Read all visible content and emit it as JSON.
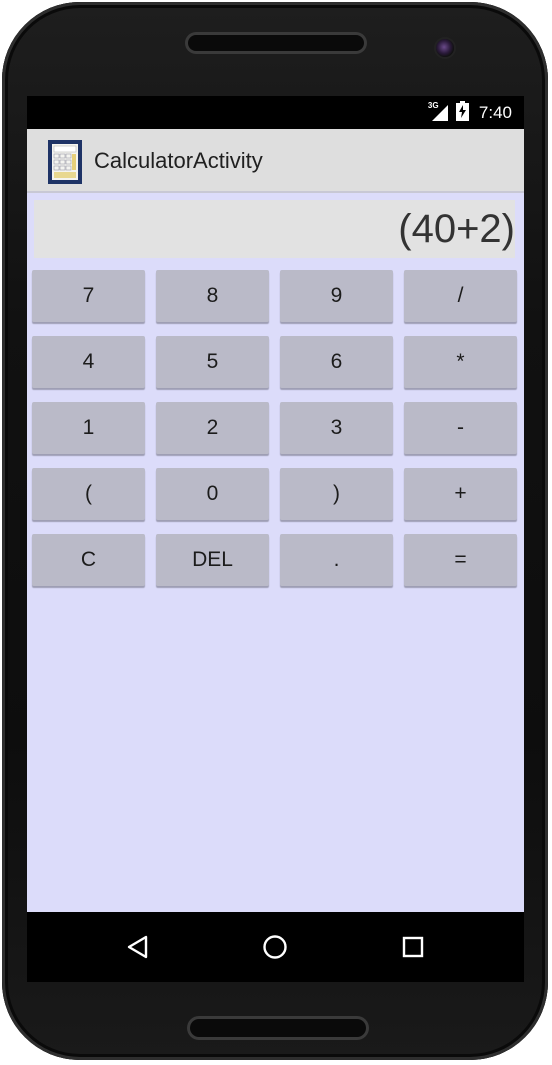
{
  "status_bar": {
    "network": "3G",
    "time": "7:40",
    "icons": [
      "signal-icon",
      "battery-charging-icon"
    ]
  },
  "action_bar": {
    "title": "CalculatorActivity",
    "icon": "calculator-app-icon"
  },
  "display": {
    "value": "(40+2)"
  },
  "keypad": {
    "rows": [
      [
        "7",
        "8",
        "9",
        "/"
      ],
      [
        "4",
        "5",
        "6",
        "*"
      ],
      [
        "1",
        "2",
        "3",
        "-"
      ],
      [
        "(",
        "0",
        ")",
        "+"
      ],
      [
        "C",
        "DEL",
        ".",
        "="
      ]
    ]
  },
  "nav_bar": {
    "icons": [
      "back-icon",
      "home-icon",
      "recents-icon"
    ]
  },
  "colors": {
    "content_bg": "#dcdcfa",
    "key_bg": "#babac8",
    "action_bar_bg": "#dedede",
    "display_bg": "#e2e2e2"
  }
}
